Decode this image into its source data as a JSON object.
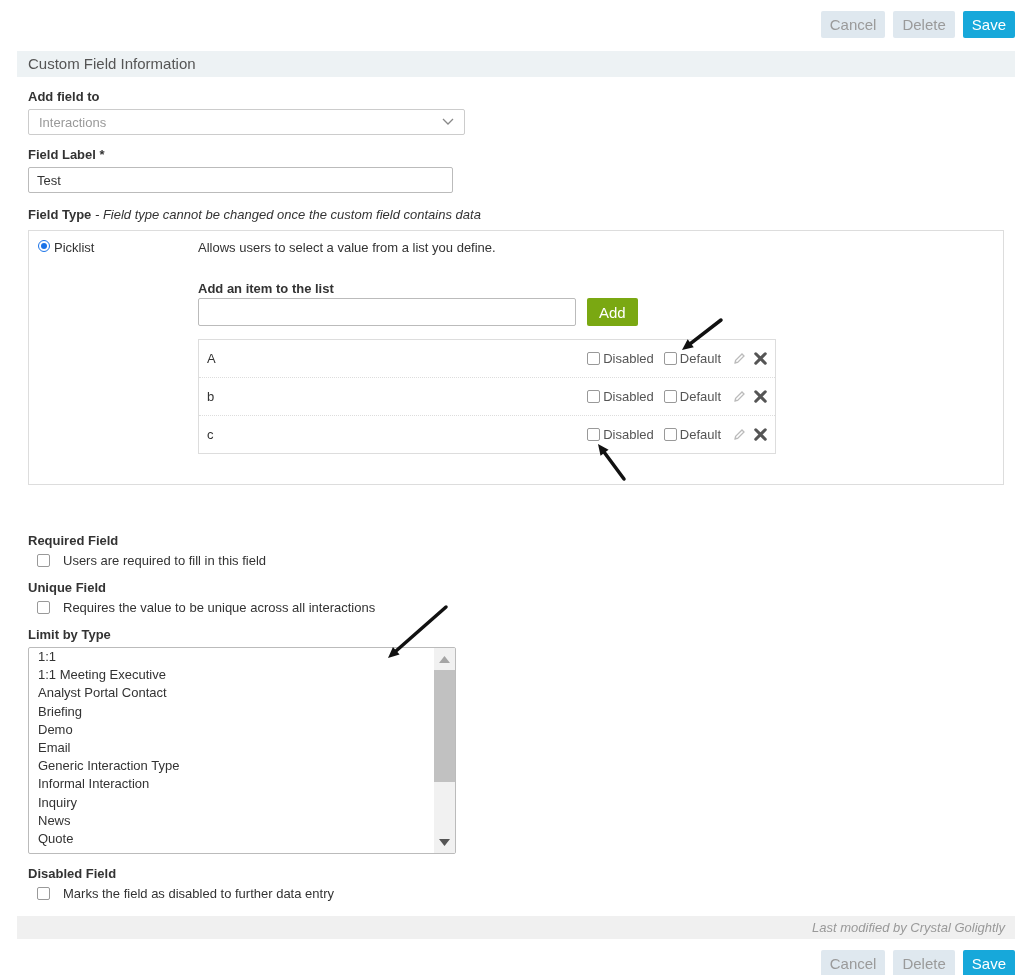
{
  "top_actions": [
    {
      "label": "Cancel",
      "kind": "secondary"
    },
    {
      "label": "Delete",
      "kind": "secondary"
    },
    {
      "label": "Save",
      "kind": "primary"
    }
  ],
  "section": {
    "title": "Custom Field Information"
  },
  "add_field_to": {
    "label": "Add field to",
    "value": "Interactions",
    "disabled": true
  },
  "field_label": {
    "label": "Field Label *",
    "value": "Test"
  },
  "field_type": {
    "heading": "**Field Type** *- Field type cannot be changed once the custom field contains data*",
    "options": [
      {
        "label": "Picklist",
        "selected": true,
        "description": "Allows users to select a value from a list you define.",
        "add_item_label": "Add an item to the list",
        "add_button": "Add",
        "items": [
          {
            "value": "A",
            "disabled": false,
            "disabled_label": "Disabled",
            "default": false,
            "default_label": "Default",
            "default_callout": true,
            "disabled_callout": false
          },
          {
            "value": "b",
            "disabled": false,
            "disabled_label": "Disabled",
            "default": false,
            "default_label": "Default",
            "default_callout": false,
            "disabled_callout": false
          },
          {
            "value": "c",
            "disabled": false,
            "disabled_label": "Disabled",
            "default": false,
            "default_label": "Default",
            "default_callout": false,
            "disabled_callout": true
          }
        ]
      }
    ]
  },
  "required_field": {
    "label": "Required Field",
    "text": "Users are required to fill in this field",
    "checked": false
  },
  "unique_field": {
    "label": "Unique Field",
    "text": "Requires the value to be unique across all interactions",
    "checked": false
  },
  "limit_by_type": {
    "label": "Limit by Type",
    "callout": true,
    "items": [
      {
        "label": "1:1",
        "selected": false
      },
      {
        "label": "1:1 Meeting Executive",
        "selected": false
      },
      {
        "label": "Analyst Portal Contact",
        "selected": false
      },
      {
        "label": "Briefing",
        "selected": false
      },
      {
        "label": "Demo",
        "selected": false
      },
      {
        "label": "Email",
        "selected": false
      },
      {
        "label": "Generic Interaction Type",
        "selected": false
      },
      {
        "label": "Informal Interaction",
        "selected": false
      },
      {
        "label": "Inquiry",
        "selected": false
      },
      {
        "label": "News",
        "selected": false
      },
      {
        "label": "Quote",
        "selected": false
      }
    ]
  },
  "disabled_field": {
    "label": "Disabled Field",
    "text": "Marks the field as disabled to further data entry",
    "checked": false
  },
  "footer": {
    "modified": "Last modified by Crystal Golightly"
  },
  "bottom_actions": [
    {
      "label": "Cancel",
      "kind": "secondary"
    },
    {
      "label": "Delete",
      "kind": "secondary"
    },
    {
      "label": "Save",
      "kind": "primary"
    }
  ]
}
